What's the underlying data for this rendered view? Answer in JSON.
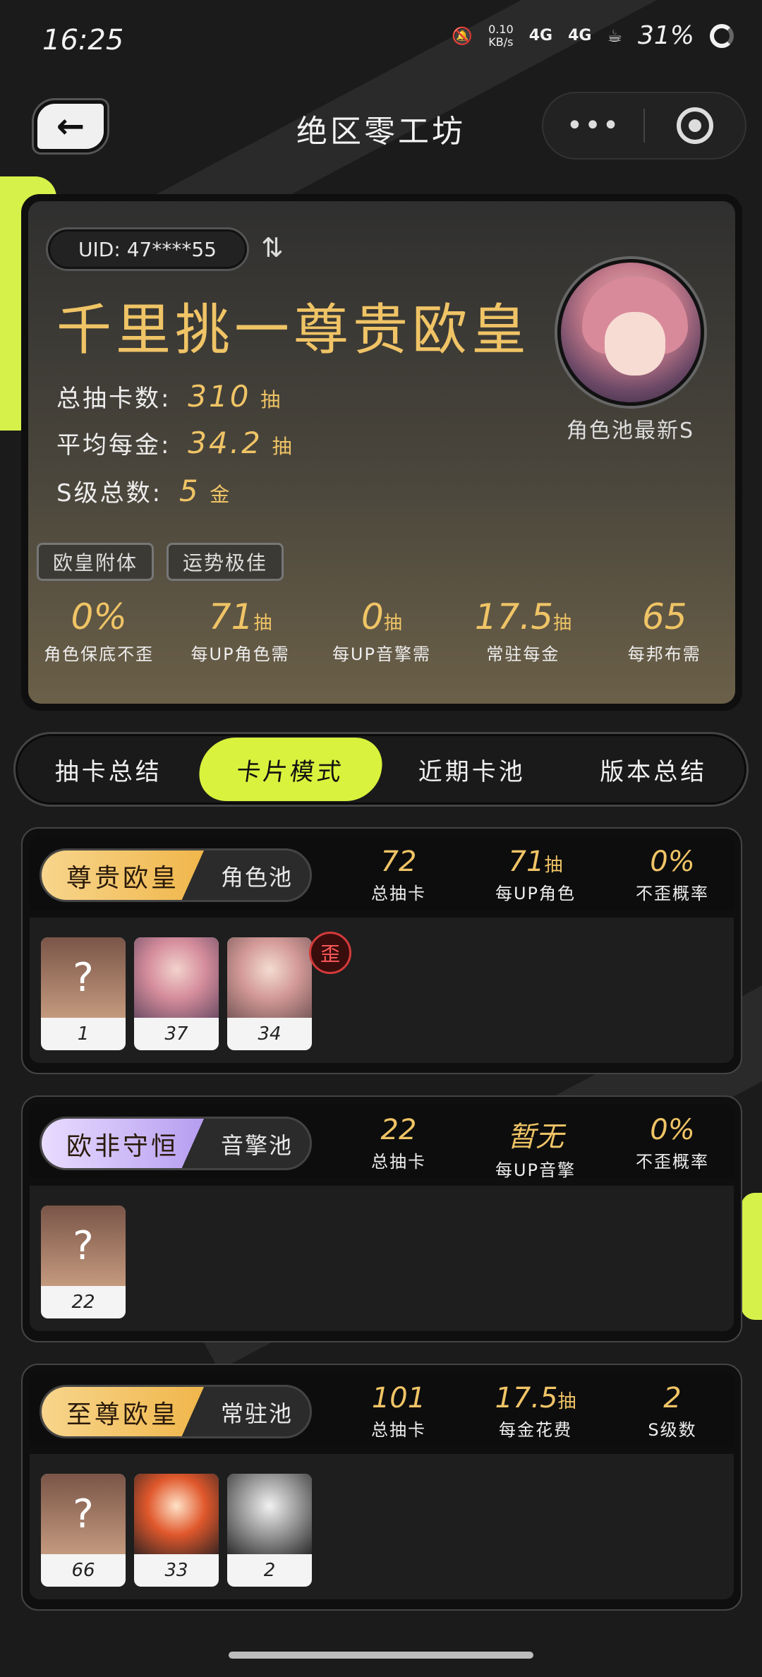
{
  "status_bar": {
    "time": "16:25",
    "net_speed": "0.10",
    "net_speed_unit": "KB/s",
    "signal1": "4G",
    "signal2": "4G",
    "battery": "31%"
  },
  "header": {
    "title": "绝区零工坊",
    "more_icon": "more-dots-icon",
    "target_icon": "target-icon"
  },
  "summary": {
    "uid": "UID: 47****55",
    "rank_title": "千里挑一尊贵欧皇",
    "total_pulls_label": "总抽卡数:",
    "total_pulls_value": "310",
    "total_pulls_unit": "抽",
    "avg_gold_label": "平均每金:",
    "avg_gold_value": "34.2",
    "avg_gold_unit": "抽",
    "s_total_label": "S级总数:",
    "s_total_value": "5",
    "s_total_unit": "金",
    "avatar_caption": "角色池最新S",
    "tags": [
      "欧皇附体",
      "运势极佳"
    ],
    "metrics": [
      {
        "value": "0%",
        "unit": "",
        "label": "角色保底不歪"
      },
      {
        "value": "71",
        "unit": "抽",
        "label": "每UP角色需"
      },
      {
        "value": "0",
        "unit": "抽",
        "label": "每UP音擎需"
      },
      {
        "value": "17.5",
        "unit": "抽",
        "label": "常驻每金"
      },
      {
        "value": "65",
        "unit": "",
        "label": "每邦布需"
      }
    ]
  },
  "tabs": [
    {
      "label": "抽卡总结",
      "active": false
    },
    {
      "label": "卡片模式",
      "active": true
    },
    {
      "label": "近期卡池",
      "active": false
    },
    {
      "label": "版本总结",
      "active": false
    }
  ],
  "pools": [
    {
      "rank": "尊贵欧皇",
      "type": "角色池",
      "stats": [
        {
          "value": "72",
          "unit": "",
          "label": "总抽卡"
        },
        {
          "value": "71",
          "unit": "抽",
          "label": "每UP角色"
        },
        {
          "value": "0%",
          "unit": "",
          "label": "不歪概率"
        }
      ],
      "chips": [
        "1",
        "37",
        "34"
      ],
      "badge": "歪"
    },
    {
      "rank": "欧非守恒",
      "type": "音擎池",
      "stats": [
        {
          "value": "22",
          "unit": "",
          "label": "总抽卡"
        },
        {
          "value": "暂无",
          "unit": "",
          "label": "每UP音擎"
        },
        {
          "value": "0%",
          "unit": "",
          "label": "不歪概率"
        }
      ],
      "chips": [
        "22"
      ]
    },
    {
      "rank": "至尊欧皇",
      "type": "常驻池",
      "stats": [
        {
          "value": "101",
          "unit": "",
          "label": "总抽卡"
        },
        {
          "value": "17.5",
          "unit": "抽",
          "label": "每金花费"
        },
        {
          "value": "2",
          "unit": "",
          "label": "S级数"
        }
      ],
      "chips": [
        "66",
        "33",
        "2"
      ]
    }
  ],
  "mystery_mark": "?",
  "colors": {
    "accent": "#d9f23d",
    "gold_text": "#f0c466",
    "background": "#1b1b1b"
  }
}
